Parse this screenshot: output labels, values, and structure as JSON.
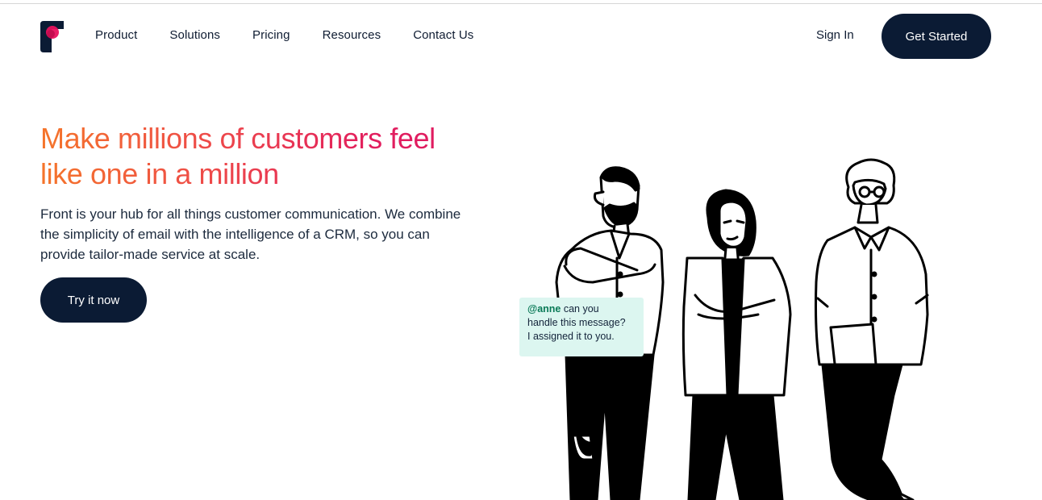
{
  "nav": {
    "items": [
      "Product",
      "Solutions",
      "Pricing",
      "Resources",
      "Contact Us"
    ],
    "sign_in": "Sign In",
    "get_started": "Get Started"
  },
  "hero": {
    "headline_line1": "Make millions of customers feel",
    "headline_line2": "like one in a million",
    "description_line1": "Front is your hub for all things customer communication. We combine",
    "description_line2": "the simplicity of email with the intelligence of a CRM, so you can",
    "description_line3": "provide tailor-made service at scale.",
    "cta": "Try it now"
  },
  "chat": {
    "mention": "@anne",
    "line1_rest": " can you",
    "line2": "handle this message?",
    "line3": "I assigned it to you."
  },
  "colors": {
    "brand_dark": "#0b1b34",
    "gradient_start": "#f5752a",
    "gradient_end": "#dc1a63",
    "chat_bg": "#dcf6f0",
    "mention": "#0a7a57"
  }
}
